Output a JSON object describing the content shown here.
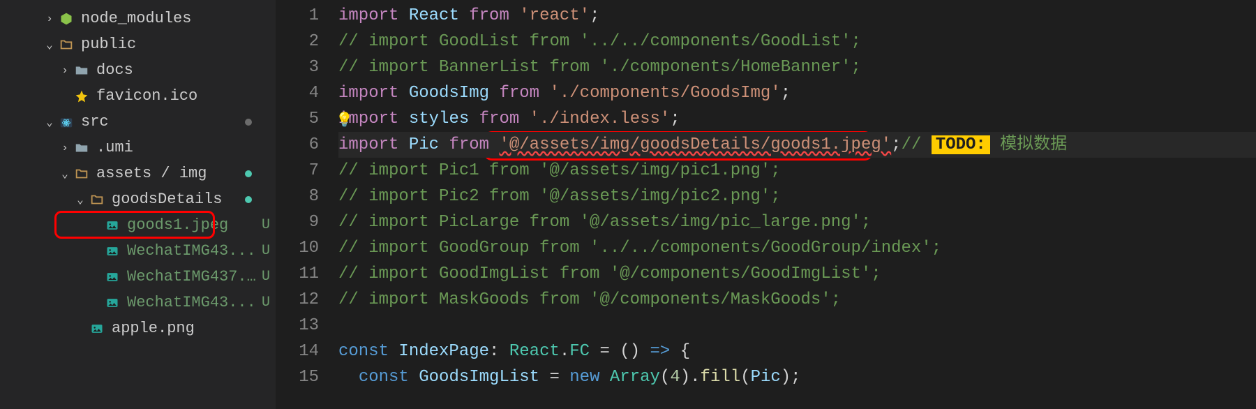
{
  "sidebar": {
    "items": [
      {
        "indent": 60,
        "chev": "›",
        "icon": "nodejs",
        "label": "node_modules",
        "status": "",
        "dot": ""
      },
      {
        "indent": 60,
        "chev": "⌄",
        "icon": "folder-open",
        "label": "public",
        "status": "",
        "dot": ""
      },
      {
        "indent": 82,
        "chev": "›",
        "icon": "folder-dark",
        "label": "docs",
        "status": "",
        "dot": ""
      },
      {
        "indent": 82,
        "chev": "",
        "icon": "star",
        "label": "favicon.ico",
        "status": "",
        "dot": ""
      },
      {
        "indent": 60,
        "chev": "⌄",
        "icon": "react",
        "label": "src",
        "status": "",
        "dot": "red"
      },
      {
        "indent": 82,
        "chev": "›",
        "icon": "folder-dark",
        "label": ".umi",
        "status": "",
        "dot": ""
      },
      {
        "indent": 82,
        "chev": "⌄",
        "icon": "folder-open",
        "label": "assets / img",
        "status": "",
        "dot": "green"
      },
      {
        "indent": 104,
        "chev": "⌄",
        "icon": "folder-open",
        "label": "goodsDetails",
        "status": "",
        "dot": "green"
      },
      {
        "indent": 126,
        "chev": "",
        "icon": "image",
        "label": "goods1.jpeg",
        "status": "U",
        "dot": "",
        "highlight": true
      },
      {
        "indent": 126,
        "chev": "",
        "icon": "image",
        "label": "WechatIMG43...",
        "status": "U",
        "dot": ""
      },
      {
        "indent": 126,
        "chev": "",
        "icon": "image",
        "label": "WechatIMG437...",
        "status": "U",
        "dot": ""
      },
      {
        "indent": 126,
        "chev": "",
        "icon": "image",
        "label": "WechatIMG43...",
        "status": "U",
        "dot": ""
      },
      {
        "indent": 104,
        "chev": "",
        "icon": "image",
        "label": "apple.png",
        "status": "",
        "dot": ""
      }
    ]
  },
  "editor": {
    "lines": [
      {
        "n": 1,
        "tokens": [
          [
            "keyword",
            "import"
          ],
          [
            "default",
            " "
          ],
          [
            "var",
            "React"
          ],
          [
            "default",
            " "
          ],
          [
            "from",
            "from"
          ],
          [
            "default",
            " "
          ],
          [
            "string",
            "'react'"
          ],
          [
            "punc",
            ";"
          ]
        ]
      },
      {
        "n": 2,
        "tokens": [
          [
            "comment",
            "// import GoodList from '../../components/GoodList';"
          ]
        ]
      },
      {
        "n": 3,
        "tokens": [
          [
            "comment",
            "// import BannerList from './components/HomeBanner';"
          ]
        ]
      },
      {
        "n": 4,
        "tokens": [
          [
            "keyword",
            "import"
          ],
          [
            "default",
            " "
          ],
          [
            "var",
            "GoodsImg"
          ],
          [
            "default",
            " "
          ],
          [
            "from",
            "from"
          ],
          [
            "default",
            " "
          ],
          [
            "string",
            "'./components/GoodsImg'"
          ],
          [
            "punc",
            ";"
          ]
        ]
      },
      {
        "n": 5,
        "bulb": true,
        "tokens": [
          [
            "keyword",
            "import"
          ],
          [
            "default",
            " "
          ],
          [
            "var",
            "styles"
          ],
          [
            "default",
            " "
          ],
          [
            "from",
            "from"
          ],
          [
            "default",
            " "
          ],
          [
            "string",
            "'./index.less'"
          ],
          [
            "punc",
            ";"
          ]
        ]
      },
      {
        "n": 6,
        "active": true,
        "tokens": [
          [
            "keyword",
            "import"
          ],
          [
            "default",
            " "
          ],
          [
            "var",
            "Pic"
          ],
          [
            "default",
            " "
          ],
          [
            "from",
            "from"
          ],
          [
            "default",
            " "
          ],
          [
            "string-err",
            "'@/assets/img/goodsDetails/goods1.jpeg'"
          ],
          [
            "punc",
            ";"
          ],
          [
            "comment",
            "// "
          ],
          [
            "todo-tag",
            "TODO:"
          ],
          [
            "todo-text",
            " 模拟数据"
          ]
        ]
      },
      {
        "n": 7,
        "tokens": [
          [
            "comment",
            "// import Pic1 from '@/assets/img/pic1.png';"
          ]
        ]
      },
      {
        "n": 8,
        "tokens": [
          [
            "comment",
            "// import Pic2 from '@/assets/img/pic2.png';"
          ]
        ]
      },
      {
        "n": 9,
        "tokens": [
          [
            "comment",
            "// import PicLarge from '@/assets/img/pic_large.png';"
          ]
        ]
      },
      {
        "n": 10,
        "tokens": [
          [
            "comment",
            "// import GoodGroup from '../../components/GoodGroup/index';"
          ]
        ]
      },
      {
        "n": 11,
        "tokens": [
          [
            "comment",
            "// import GoodImgList from '@/components/GoodImgList';"
          ]
        ]
      },
      {
        "n": 12,
        "tokens": [
          [
            "comment",
            "// import MaskGoods from '@/components/MaskGoods';"
          ]
        ]
      },
      {
        "n": 13,
        "tokens": []
      },
      {
        "n": 14,
        "tokens": [
          [
            "const",
            "const"
          ],
          [
            "default",
            " "
          ],
          [
            "var",
            "IndexPage"
          ],
          [
            "punc",
            ": "
          ],
          [
            "type",
            "React"
          ],
          [
            "punc",
            "."
          ],
          [
            "type",
            "FC"
          ],
          [
            "default",
            " "
          ],
          [
            "punc",
            "= () "
          ],
          [
            "const",
            "=>"
          ],
          [
            "default",
            " "
          ],
          [
            "punc",
            "{"
          ]
        ]
      },
      {
        "n": 15,
        "tokens": [
          [
            "default",
            "  "
          ],
          [
            "const",
            "const"
          ],
          [
            "default",
            " "
          ],
          [
            "var",
            "GoodsImgList"
          ],
          [
            "default",
            " "
          ],
          [
            "punc",
            "= "
          ],
          [
            "const",
            "new"
          ],
          [
            "default",
            " "
          ],
          [
            "class",
            "Array"
          ],
          [
            "punc",
            "("
          ],
          [
            "number",
            "4"
          ],
          [
            "punc",
            ")."
          ],
          [
            "func",
            "fill"
          ],
          [
            "punc",
            "("
          ],
          [
            "var",
            "Pic"
          ],
          [
            "punc",
            ");"
          ]
        ]
      }
    ]
  }
}
